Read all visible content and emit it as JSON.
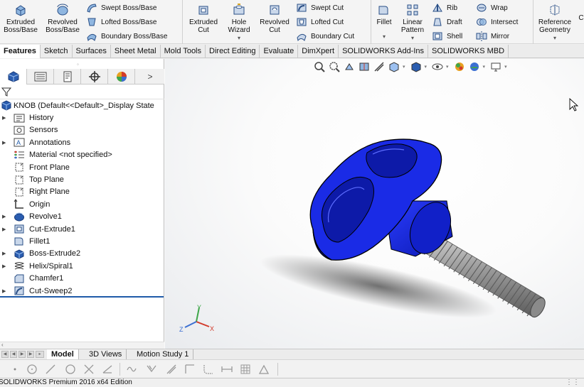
{
  "ribbon": {
    "extruded_boss": "Extruded\nBoss/Base",
    "revolved_boss": "Revolved\nBoss/Base",
    "swept_boss": "Swept Boss/Base",
    "lofted_boss": "Lofted Boss/Base",
    "boundary_boss": "Boundary Boss/Base",
    "extruded_cut": "Extruded\nCut",
    "hole_wizard": "Hole\nWizard",
    "revolved_cut": "Revolved\nCut",
    "swept_cut": "Swept Cut",
    "lofted_cut": "Lofted Cut",
    "boundary_cut": "Boundary Cut",
    "fillet": "Fillet",
    "linear_pattern": "Linear\nPattern",
    "rib": "Rib",
    "draft": "Draft",
    "shell": "Shell",
    "wrap": "Wrap",
    "intersect": "Intersect",
    "mirror": "Mirror",
    "reference_geometry": "Reference\nGeometry",
    "overflow_letter": "C"
  },
  "command_tabs": [
    "Features",
    "Sketch",
    "Surfaces",
    "Sheet Metal",
    "Mold Tools",
    "Direct Editing",
    "Evaluate",
    "DimXpert",
    "SOLIDWORKS Add-Ins",
    "SOLIDWORKS MBD"
  ],
  "panel_tabs": [
    "feature-manager",
    "property-manager",
    "configuration-manager",
    "dimxpert-manager",
    "display-manager"
  ],
  "tree": {
    "root": "KNOB  (Default<<Default>_Display State",
    "items": [
      {
        "label": "History",
        "expand": true,
        "icon": "history"
      },
      {
        "label": "Sensors",
        "expand": false,
        "icon": "sensors"
      },
      {
        "label": "Annotations",
        "expand": true,
        "icon": "annotations"
      },
      {
        "label": "Material <not specified>",
        "expand": false,
        "icon": "material"
      },
      {
        "label": "Front Plane",
        "expand": false,
        "icon": "plane"
      },
      {
        "label": "Top Plane",
        "expand": false,
        "icon": "plane"
      },
      {
        "label": "Right Plane",
        "expand": false,
        "icon": "plane"
      },
      {
        "label": "Origin",
        "expand": false,
        "icon": "origin"
      },
      {
        "label": "Revolve1",
        "expand": true,
        "icon": "revolve"
      },
      {
        "label": "Cut-Extrude1",
        "expand": true,
        "icon": "cut-extrude"
      },
      {
        "label": "Fillet1",
        "expand": false,
        "icon": "fillet"
      },
      {
        "label": "Boss-Extrude2",
        "expand": true,
        "icon": "boss-extrude"
      },
      {
        "label": "Helix/Spiral1",
        "expand": true,
        "icon": "helix"
      },
      {
        "label": "Chamfer1",
        "expand": false,
        "icon": "chamfer"
      },
      {
        "label": "Cut-Sweep2",
        "expand": true,
        "icon": "cut-sweep"
      }
    ]
  },
  "bottom_tabs": [
    "Model",
    "3D Views",
    "Motion Study 1"
  ],
  "status_text": "SOLIDWORKS Premium 2016 x64 Edition",
  "triad": {
    "x": "X",
    "y": "Y",
    "z": "Z"
  },
  "colors": {
    "part": "#1f2fd6",
    "thread": "#a9a9a9",
    "accent": "#1f5aa8"
  }
}
